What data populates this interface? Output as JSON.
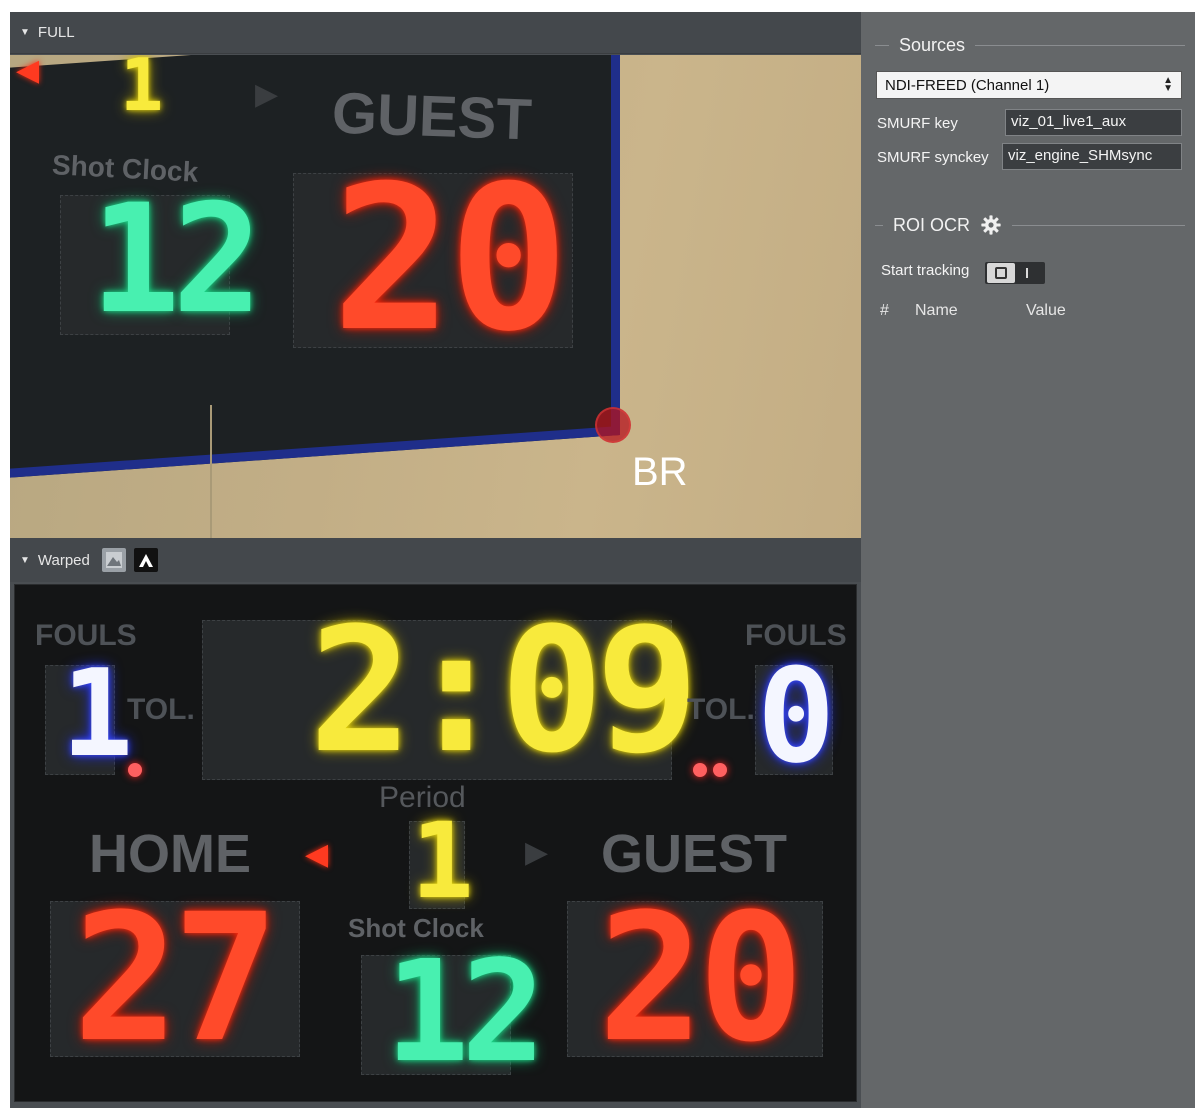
{
  "viewer": {
    "full_label": "FULL",
    "warped_label": "Warped",
    "full_image": {
      "team_label": "GUEST",
      "shot_clock_label": "Shot Clock",
      "shot_clock_value": "12",
      "guest_score": "20",
      "period_value": "1",
      "corner_label": "BR"
    },
    "warped_image": {
      "fouls_left_label": "FOULS",
      "fouls_left_value": "1",
      "tol_left_label": "TOL.",
      "time_value": "2:09",
      "tol_right_label": "TOL.",
      "fouls_right_label": "FOULS",
      "fouls_right_value": "0",
      "period_label": "Period",
      "period_value": "1",
      "home_label": "HOME",
      "guest_label": "GUEST",
      "home_score": "27",
      "shot_clock_label": "Shot Clock",
      "shot_clock_value": "12",
      "guest_score": "20"
    }
  },
  "settings": {
    "sources_title": "Sources",
    "source_selected": "NDI-FREED (Channel 1)",
    "smurf_key_label": "SMURF key",
    "smurf_key_value": "viz_01_live1_aux",
    "smurf_synckey_label": "SMURF synckey",
    "smurf_synckey_value": "viz_engine_SHMsync",
    "roi_title": "ROI OCR",
    "start_tracking_label": "Start tracking",
    "columns": {
      "index": "#",
      "name": "Name",
      "value": "Value"
    }
  },
  "colors": {
    "panel_bg": "#646769",
    "viewer_bg": "#4a4e52",
    "led_red": "#ff4a2a",
    "led_green": "#48f0b0",
    "led_yellow": "#f8ea3c",
    "led_blue": "#3040ff",
    "marker_red": "#b4141e"
  },
  "icons": [
    "collapse-triangle-icon",
    "image-view-icon",
    "contrast-view-icon",
    "gear-icon",
    "select-arrows-icon",
    "camera-toggle-icon"
  ]
}
